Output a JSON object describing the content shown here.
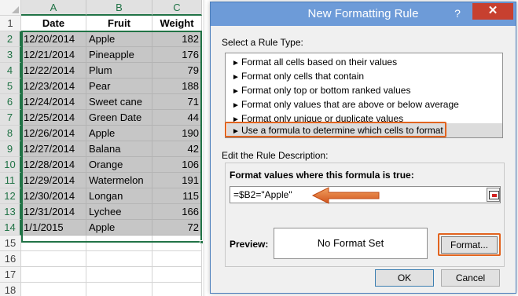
{
  "spreadsheet": {
    "columns": [
      "A",
      "B",
      "C"
    ],
    "row_numbers": [
      "1",
      "2",
      "3",
      "4",
      "5",
      "6",
      "7",
      "8",
      "9",
      "10",
      "11",
      "12",
      "13",
      "14",
      "15",
      "16",
      "17",
      "18"
    ],
    "headers": [
      "Date",
      "Fruit",
      "Weight"
    ],
    "rows": [
      {
        "date": "12/20/2014",
        "fruit": "Apple",
        "weight": "182"
      },
      {
        "date": "12/21/2014",
        "fruit": "Pineapple",
        "weight": "176"
      },
      {
        "date": "12/22/2014",
        "fruit": "Plum",
        "weight": "79"
      },
      {
        "date": "12/23/2014",
        "fruit": "Pear",
        "weight": "188"
      },
      {
        "date": "12/24/2014",
        "fruit": "Sweet cane",
        "weight": "71"
      },
      {
        "date": "12/25/2014",
        "fruit": "Green Date",
        "weight": "44"
      },
      {
        "date": "12/26/2014",
        "fruit": "Apple",
        "weight": "190"
      },
      {
        "date": "12/27/2014",
        "fruit": "Balana",
        "weight": "42"
      },
      {
        "date": "12/28/2014",
        "fruit": "Orange",
        "weight": "106"
      },
      {
        "date": "12/29/2014",
        "fruit": "Watermelon",
        "weight": "191"
      },
      {
        "date": "12/30/2014",
        "fruit": "Longan",
        "weight": "115"
      },
      {
        "date": "12/31/2014",
        "fruit": "Lychee",
        "weight": "166"
      },
      {
        "date": "1/1/2015",
        "fruit": "Apple",
        "weight": "72"
      }
    ]
  },
  "dialog": {
    "title": "New Formatting Rule",
    "help_glyph": "?",
    "close_glyph": "✕",
    "select_rule_type_label": "Select a Rule Type:",
    "rule_types": [
      "Format all cells based on their values",
      "Format only cells that contain",
      "Format only top or bottom ranked values",
      "Format only values that are above or below average",
      "Format only unique or duplicate values",
      "Use a formula to determine which cells to format"
    ],
    "selected_rule_index": 5,
    "edit_description_label": "Edit the Rule Description:",
    "formula_label": "Format values where this formula is true:",
    "formula_value": "=$B2=\"Apple\"",
    "preview_label": "Preview:",
    "preview_text": "No Format Set",
    "format_button": "Format...",
    "ok_button": "OK",
    "cancel_button": "Cancel"
  },
  "colors": {
    "excel_green": "#217346",
    "selection_shade": "#c6c6c6",
    "title_bar": "#6d9bd8",
    "close_red": "#c7402f",
    "highlight_orange": "#e2641f"
  }
}
